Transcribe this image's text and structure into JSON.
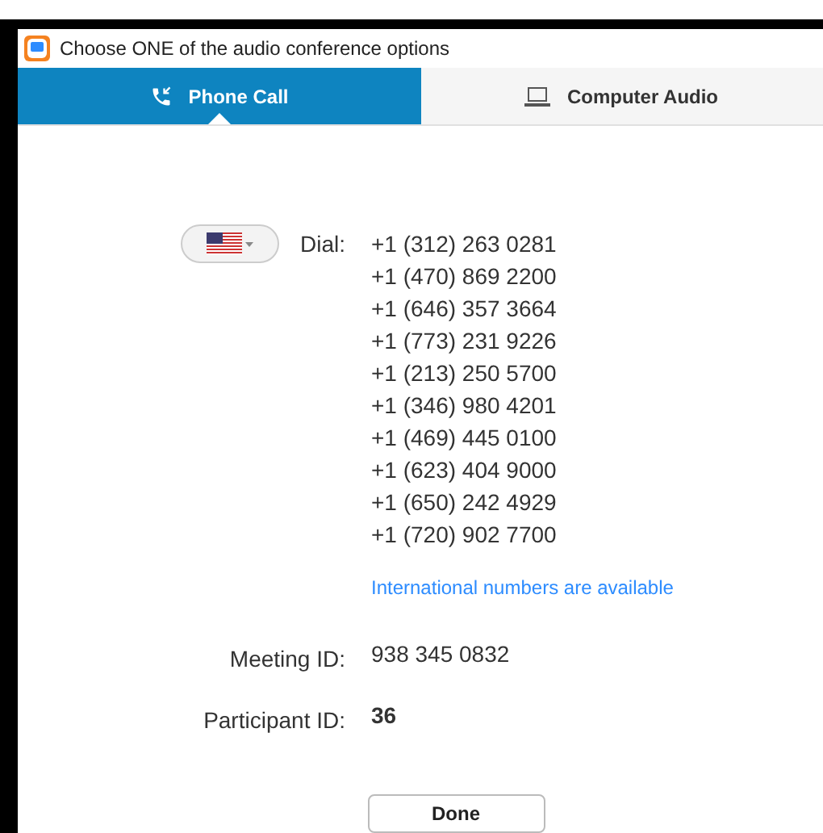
{
  "window": {
    "title": "Choose ONE of the audio conference options"
  },
  "tabs": [
    {
      "label": "Phone Call",
      "kind": "phone",
      "selected": true
    },
    {
      "label": "Computer Audio",
      "kind": "computer",
      "selected": false
    }
  ],
  "dial": {
    "label": "Dial:",
    "numbers": [
      "+1 (312) 263 0281",
      "+1 (470) 869 2200",
      "+1 (646) 357 3664",
      "+1 (773) 231 9226",
      "+1 (213) 250 5700",
      "+1 (346) 980 4201",
      "+1 (469) 445 0100",
      "+1 (623) 404 9000",
      "+1 (650) 242 4929",
      "+1 (720) 902 7700"
    ],
    "link": "International numbers are available"
  },
  "meeting_id": {
    "label": "Meeting ID:",
    "value": "938 345 0832"
  },
  "participant_id": {
    "label": "Participant ID:",
    "value": "36"
  },
  "buttons": [
    "Done"
  ]
}
